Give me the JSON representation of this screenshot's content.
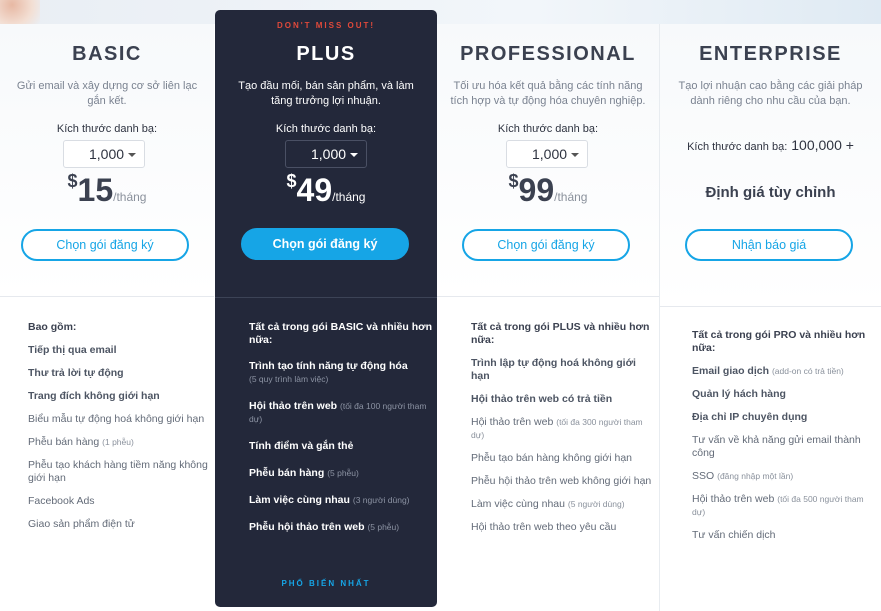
{
  "plans": {
    "basic": {
      "name": "BASIC",
      "description": "Gửi email và xây dựng cơ sở liên lạc gắn kết.",
      "contact_size_label": "Kích thước danh bạ:",
      "contact_size_value": "1,000",
      "currency": "$",
      "price": "15",
      "period": "/tháng",
      "cta": "Chọn gói đăng ký",
      "features_heading": "Bao gồm:",
      "features": [
        {
          "text": "Tiếp thị qua email",
          "note": ""
        },
        {
          "text": "Thư trả lời tự động",
          "note": ""
        },
        {
          "text": "Trang đích không giới hạn",
          "note": ""
        },
        {
          "text": "Biểu mẫu tự động hoá không giới hạn",
          "note": ""
        },
        {
          "text": "Phễu bán hàng",
          "note": "(1 phễu)"
        },
        {
          "text": "Phễu tạo khách hàng tiềm năng không giới hạn",
          "note": ""
        },
        {
          "text": "Facebook Ads",
          "note": ""
        },
        {
          "text": "Giao sản phẩm điện tử",
          "note": ""
        }
      ]
    },
    "plus": {
      "tag": "DON'T MISS OUT!",
      "name": "PLUS",
      "description": "Tạo đầu mối, bán sản phẩm, và làm tăng trưởng lợi nhuận.",
      "contact_size_label": "Kích thước danh bạ:",
      "contact_size_value": "1,000",
      "currency": "$",
      "price": "49",
      "period": "/tháng",
      "cta": "Chọn gói đăng ký",
      "features_heading": "Tất cả trong gói BASIC và nhiều hơn nữa:",
      "features": [
        {
          "text": "Trình tạo tính năng tự động hóa",
          "note": "(5 quy trình làm việc)"
        },
        {
          "text": "Hội thảo trên web",
          "note": "(tối đa 100 người tham dự)"
        },
        {
          "text": "Tính điểm và gắn thẻ",
          "note": ""
        },
        {
          "text": "Phễu bán hàng",
          "note": "(5 phễu)"
        },
        {
          "text": "Làm việc cùng nhau",
          "note": "(3 người dùng)"
        },
        {
          "text": "Phễu hội thảo trên web",
          "note": "(5 phễu)"
        }
      ],
      "footer": "PHỔ BIẾN NHẤT"
    },
    "pro": {
      "name": "PROFESSIONAL",
      "description": "Tối ưu hóa kết quả bằng các tính năng tích hợp và tự động hóa chuyên nghiệp.",
      "contact_size_label": "Kích thước danh bạ:",
      "contact_size_value": "1,000",
      "currency": "$",
      "price": "99",
      "period": "/tháng",
      "cta": "Chọn gói đăng ký",
      "features_heading": "Tất cả trong gói PLUS và nhiều hơn nữa:",
      "features": [
        {
          "text": "Trình lập tự động hoá không giới hạn",
          "note": ""
        },
        {
          "text": "Hội thảo trên web có trả tiền",
          "note": ""
        },
        {
          "text": "Hội thảo trên web",
          "note": "(tối đa 300 người tham dự)"
        },
        {
          "text": "Phễu tạo bán hàng không giới hạn",
          "note": ""
        },
        {
          "text": "Phễu hội thảo trên web không giới hạn",
          "note": ""
        },
        {
          "text": "Làm việc cùng nhau",
          "note": "(5 người dùng)"
        },
        {
          "text": "Hội thảo trên web theo yêu cầu",
          "note": ""
        }
      ]
    },
    "enterprise": {
      "name": "ENTERPRISE",
      "description": "Tạo lợi nhuận cao bằng các giải pháp dành riêng cho nhu cầu của bạn.",
      "contact_size_label": "Kích thước danh bạ:",
      "contact_size_value": "100,000 +",
      "custom_pricing": "Định giá tùy chỉnh",
      "cta": "Nhận báo giá",
      "features_heading": "Tất cả trong gói PRO và nhiều hơn nữa:",
      "features": [
        {
          "text": "Email giao dịch",
          "note": "(add-on có trả tiền)"
        },
        {
          "text": "Quản lý hách hàng",
          "note": ""
        },
        {
          "text": "Địa chỉ IP chuyên dụng",
          "note": ""
        },
        {
          "text": "Tư vấn về khả năng gửi email thành công",
          "note": ""
        },
        {
          "text": "SSO",
          "note": "(đăng nhập một lần)"
        },
        {
          "text": "Hội thảo trên web",
          "note": "(tối đa 500 người tham dự)"
        },
        {
          "text": "Tư vấn chiến dịch",
          "note": ""
        }
      ]
    }
  },
  "colors": {
    "accent": "#16a5e6",
    "plus_bg": "#23283a",
    "alert": "#e0493a"
  }
}
